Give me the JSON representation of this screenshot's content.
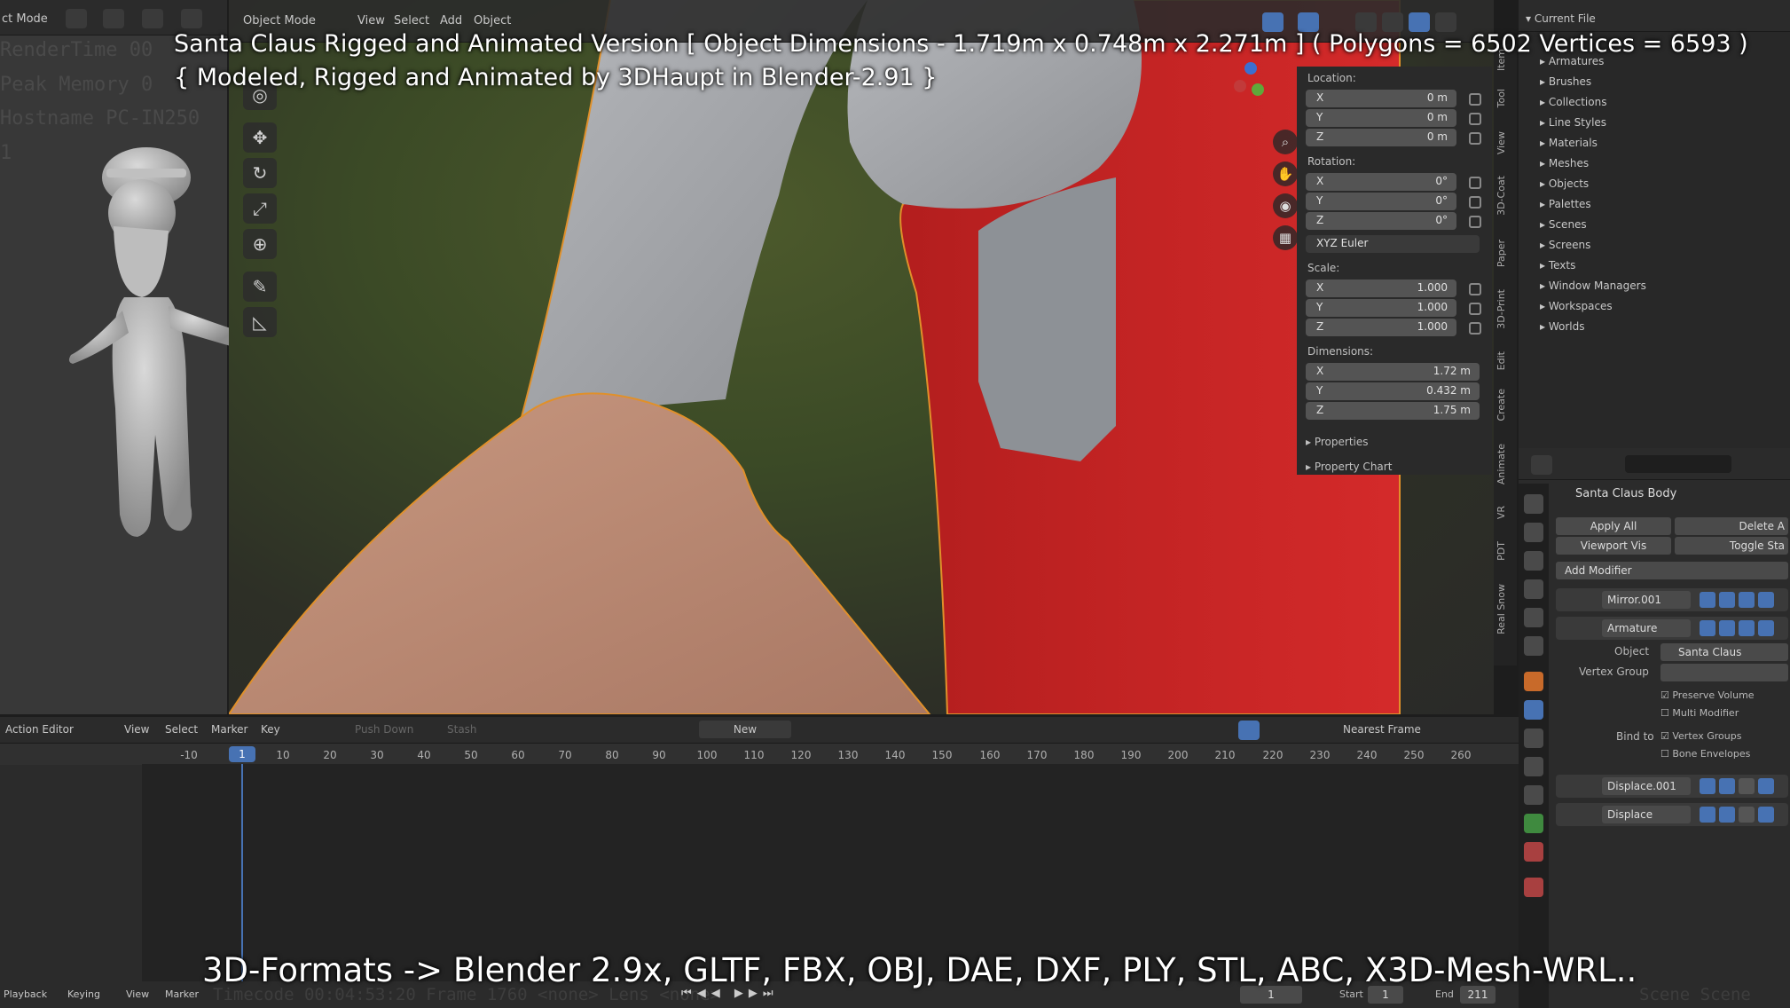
{
  "overlay": {
    "title_line1": "Santa Claus Rigged and Animated Version [ Object Dimensions -  1.719m x 0.748m x 2.271m ] ( Polygons = 6502  Vertices = 6593 )",
    "title_line2": "{ Modeled, Rigged and Animated by 3DHaupt in Blender-2.91 }",
    "footer": "3D-Formats -> Blender 2.9x, GLTF, FBX, OBJ, DAE, DXF, PLY, STL, ABC, X3D-Mesh-WRL.."
  },
  "left_view": {
    "mode": "ct Mode",
    "debug_lines": [
      "RenderTime 00",
      "Peak Memory 0",
      "Hostname PC-IN250",
      "1"
    ]
  },
  "viewport_header": {
    "mode": "Object Mode",
    "menus": [
      "View",
      "Select",
      "Add",
      "Object"
    ]
  },
  "npanel": {
    "location_label": "Location:",
    "location": [
      {
        "axis": "X",
        "value": "0 m"
      },
      {
        "axis": "Y",
        "value": "0 m"
      },
      {
        "axis": "Z",
        "value": "0 m"
      }
    ],
    "rotation_label": "Rotation:",
    "rotation": [
      {
        "axis": "X",
        "value": "0°"
      },
      {
        "axis": "Y",
        "value": "0°"
      },
      {
        "axis": "Z",
        "value": "0°"
      }
    ],
    "rotation_mode": "XYZ Euler",
    "scale_label": "Scale:",
    "scale": [
      {
        "axis": "X",
        "value": "1.000"
      },
      {
        "axis": "Y",
        "value": "1.000"
      },
      {
        "axis": "Z",
        "value": "1.000"
      }
    ],
    "dimensions_label": "Dimensions:",
    "dimensions": [
      {
        "axis": "X",
        "value": "1.72 m"
      },
      {
        "axis": "Y",
        "value": "0.432 m"
      },
      {
        "axis": "Z",
        "value": "1.75 m"
      }
    ],
    "properties_label": "Properties",
    "property_chart_label": "Property Chart"
  },
  "side_tabs": [
    "Item",
    "Tool",
    "View",
    "3D-Coat",
    "Paper",
    "3D-Print",
    "Edit",
    "Create",
    "Animate",
    "VR",
    "PDT",
    "Real Snow"
  ],
  "outliner": {
    "root": "Current File",
    "items": [
      "Armatures",
      "Brushes",
      "Collections",
      "Line Styles",
      "Materials",
      "Meshes",
      "Objects",
      "Palettes",
      "Scenes",
      "Screens",
      "Texts",
      "Window Managers",
      "Workspaces",
      "Worlds"
    ]
  },
  "properties": {
    "object_name": "Santa Claus Body",
    "apply_all": "Apply All",
    "delete_all": "Delete A",
    "viewport_vis": "Viewport Vis",
    "toggle_stack": "Toggle Sta",
    "add_modifier": "Add Modifier",
    "modifiers": [
      "Mirror.001",
      "Armature",
      "Displace.001",
      "Displace"
    ],
    "armature_object_label": "Object",
    "armature_object": "Santa Claus",
    "vertex_group_label": "Vertex Group",
    "preserve_volume": "Preserve Volume",
    "multi_modifier": "Multi Modifier",
    "bind_to_label": "Bind to",
    "vertex_groups": "Vertex Groups",
    "bone_envelopes": "Bone Envelopes"
  },
  "timeline": {
    "editor": "Action Editor",
    "menus": [
      "View",
      "Select",
      "Marker",
      "Key"
    ],
    "push_down": "Push Down",
    "stash": "Stash",
    "new_label": "New",
    "snap": "Nearest Frame",
    "current_frame": "1",
    "frames": [
      "-10",
      "10",
      "20",
      "30",
      "40",
      "50",
      "60",
      "70",
      "80",
      "90",
      "100",
      "110",
      "120",
      "130",
      "140",
      "150",
      "160",
      "170",
      "180",
      "190",
      "200",
      "210",
      "220",
      "230",
      "240",
      "250",
      "260"
    ],
    "bottom_menus": [
      "Playback",
      "Keying",
      "View",
      "Marker"
    ],
    "bottom_current": "1",
    "start_label": "Start",
    "start": "1",
    "end_label": "End",
    "end": "211",
    "ghost_text": "Timecode 00:04:53:20   Frame 1760   <none>   Lens <none>",
    "ghost_right": "Scene Scene"
  }
}
